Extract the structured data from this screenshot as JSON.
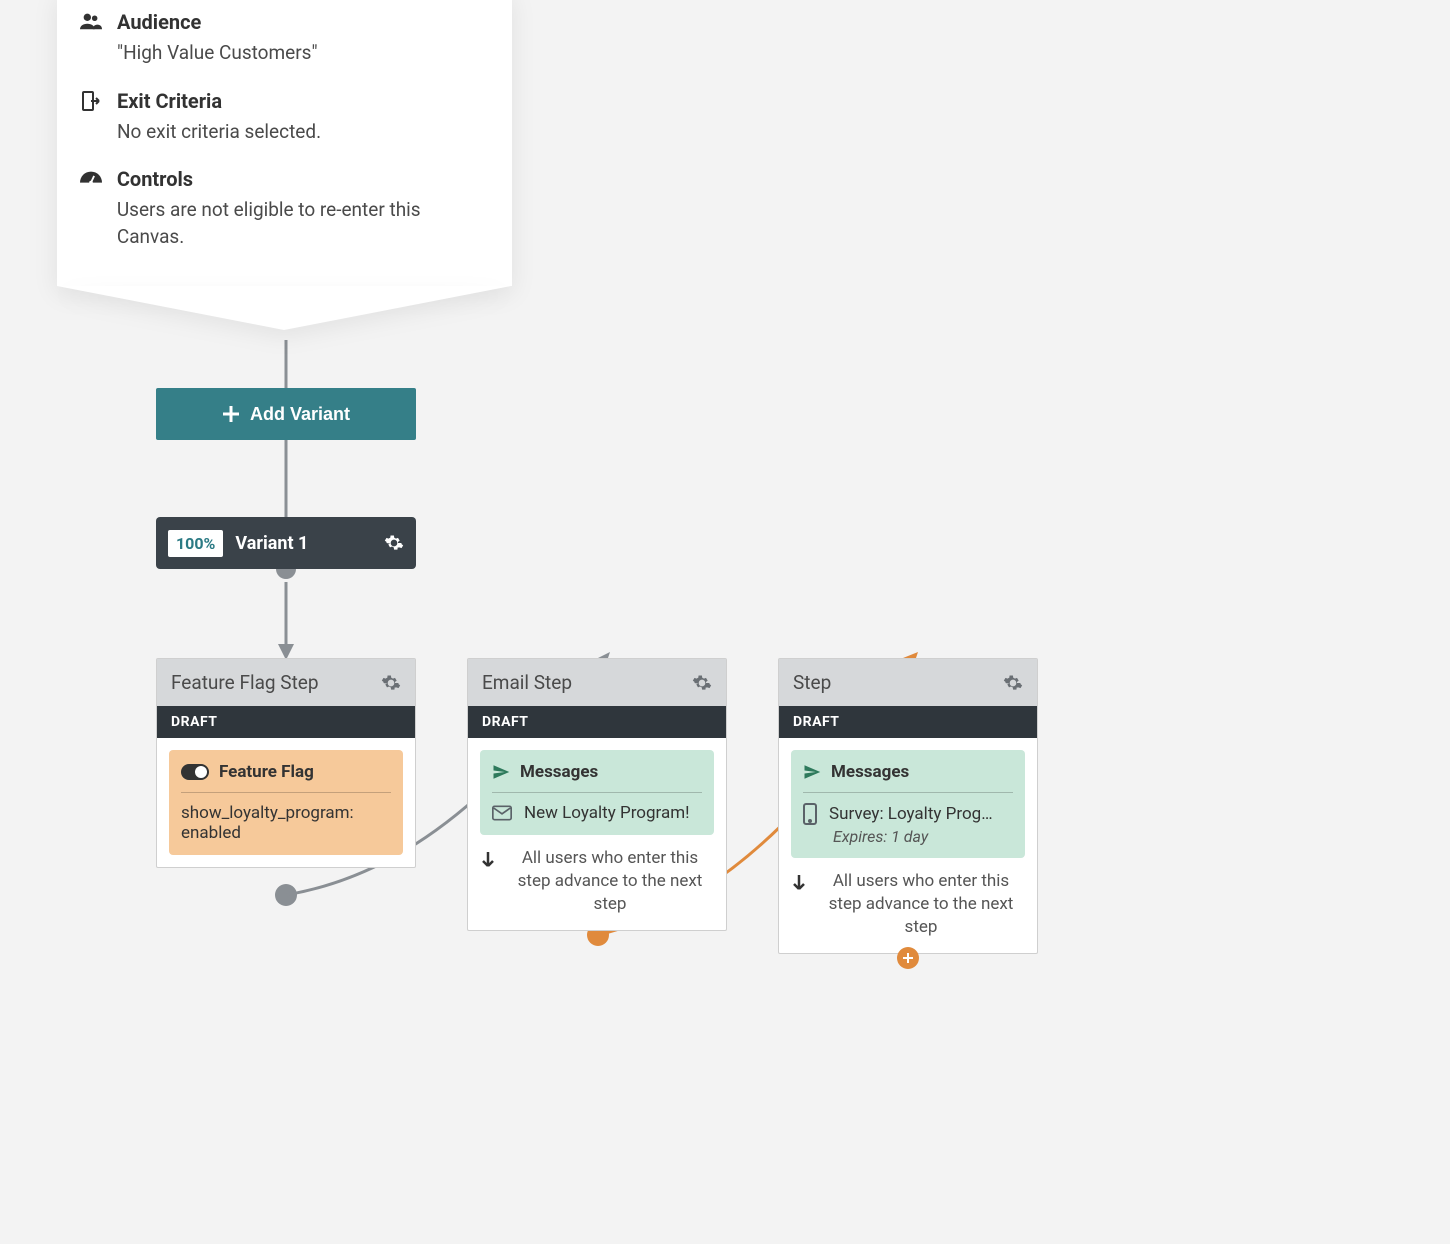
{
  "info": {
    "audience": {
      "label": "Audience",
      "value": "\"High Value Customers\""
    },
    "exit": {
      "label": "Exit Criteria",
      "value": "No exit criteria selected."
    },
    "controls": {
      "label": "Controls",
      "value": "Users are not eligible to re-enter this Canvas."
    }
  },
  "add_variant_label": "Add Variant",
  "variant": {
    "pct": "100%",
    "name": "Variant 1"
  },
  "steps": [
    {
      "title": "Feature Flag Step",
      "status": "DRAFT",
      "flag": {
        "heading": "Feature Flag",
        "text": "show_loyalty_program: enabled"
      }
    },
    {
      "title": "Email Step",
      "status": "DRAFT",
      "messages": {
        "heading": "Messages",
        "item": "New Loyalty Program!"
      },
      "advance": "All users who enter this step advance to the next step"
    },
    {
      "title": "Step",
      "status": "DRAFT",
      "messages": {
        "heading": "Messages",
        "item": "Survey: Loyalty Prog…",
        "expires": "Expires: 1 day"
      },
      "advance": "All users who enter this step advance to the next step"
    }
  ]
}
